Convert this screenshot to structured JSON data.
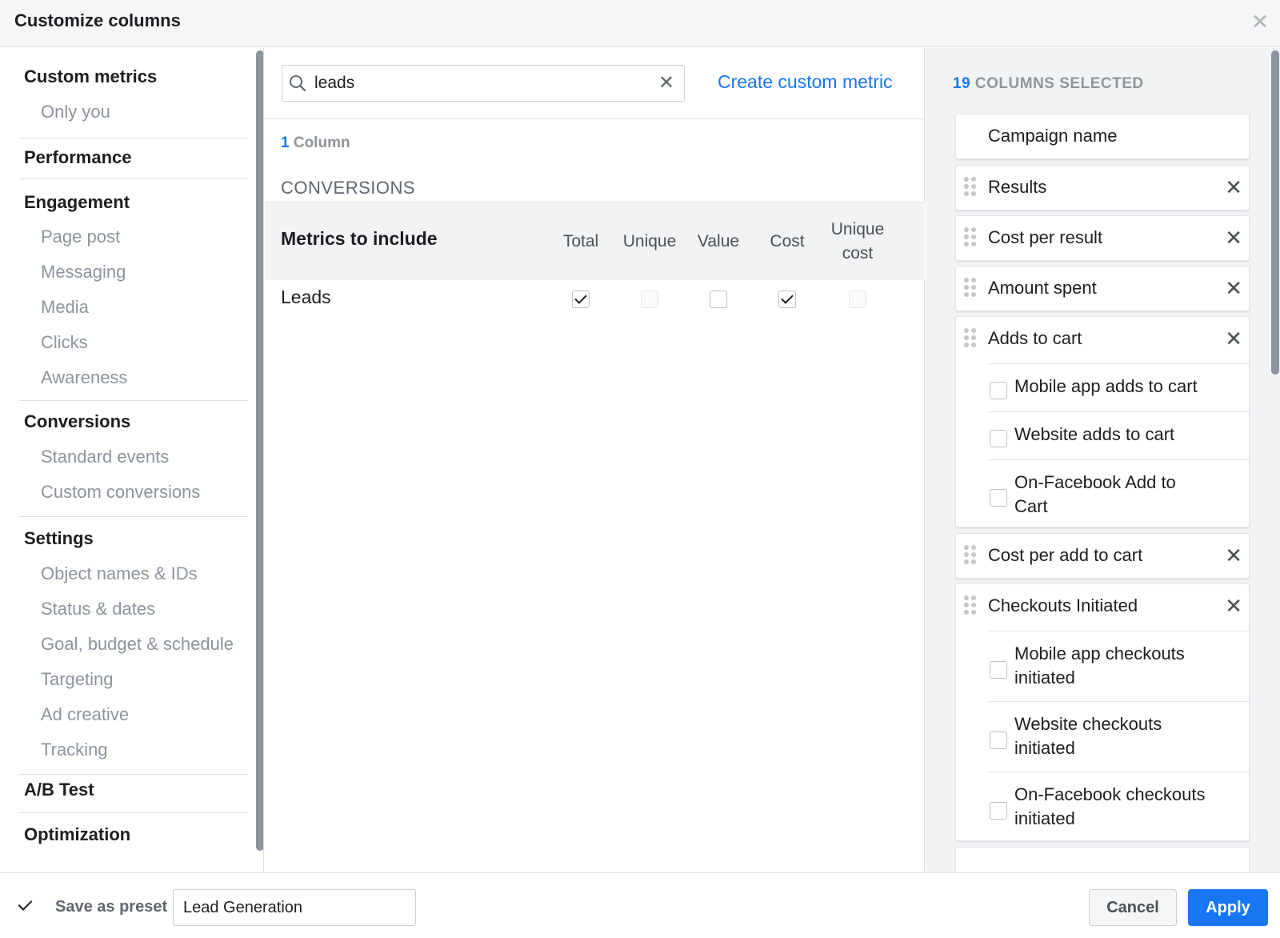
{
  "header": {
    "title": "Customize columns"
  },
  "nav": {
    "sections": [
      {
        "heading": "Custom metrics",
        "items": [
          "Only you"
        ]
      },
      {
        "heading": "Performance",
        "items": []
      },
      {
        "heading": "Engagement",
        "items": [
          "Page post",
          "Messaging",
          "Media",
          "Clicks",
          "Awareness"
        ]
      },
      {
        "heading": "Conversions",
        "items": [
          "Standard events",
          "Custom conversions"
        ]
      },
      {
        "heading": "Settings",
        "items": [
          "Object names & IDs",
          "Status & dates",
          "Goal, budget & schedule",
          "Targeting",
          "Ad creative",
          "Tracking"
        ]
      },
      {
        "heading": "A/B Test",
        "items": []
      },
      {
        "heading": "Optimization",
        "items": []
      }
    ]
  },
  "search": {
    "value": "leads"
  },
  "create_link": "Create custom metric",
  "results": {
    "count": "1",
    "count_label": "Column",
    "section": "CONVERSIONS",
    "metrics_label": "Metrics to include",
    "columns": [
      "Total",
      "Unique",
      "Value",
      "Cost",
      "Unique cost"
    ],
    "rows": [
      {
        "label": "Leads",
        "checks": [
          "checked",
          "disabled",
          "unchecked",
          "checked",
          "disabled"
        ]
      }
    ]
  },
  "selected": {
    "count": "19",
    "heading": "COLUMNS SELECTED",
    "cards": [
      {
        "label": "Campaign name",
        "removable": false,
        "subs": []
      },
      {
        "label": "Results",
        "removable": true,
        "subs": []
      },
      {
        "label": "Cost per result",
        "removable": true,
        "subs": []
      },
      {
        "label": "Amount spent",
        "removable": true,
        "subs": []
      },
      {
        "label": "Adds to cart",
        "removable": true,
        "subs": [
          "Mobile app adds to cart",
          "Website adds to cart",
          "On-Facebook Add to Cart"
        ]
      },
      {
        "label": "Cost per add to cart",
        "removable": true,
        "subs": []
      },
      {
        "label": "Checkouts Initiated",
        "removable": true,
        "subs": [
          "Mobile app checkouts initiated",
          "Website checkouts initiated",
          "On-Facebook checkouts initiated"
        ]
      }
    ]
  },
  "footer": {
    "save_preset_label": "Save as preset",
    "preset_name": "Lead Generation",
    "cancel": "Cancel",
    "apply": "Apply"
  },
  "colors": {
    "accent": "#1877f2",
    "panel_bg": "#f2f3f5",
    "muted_text": "#8d949e"
  }
}
